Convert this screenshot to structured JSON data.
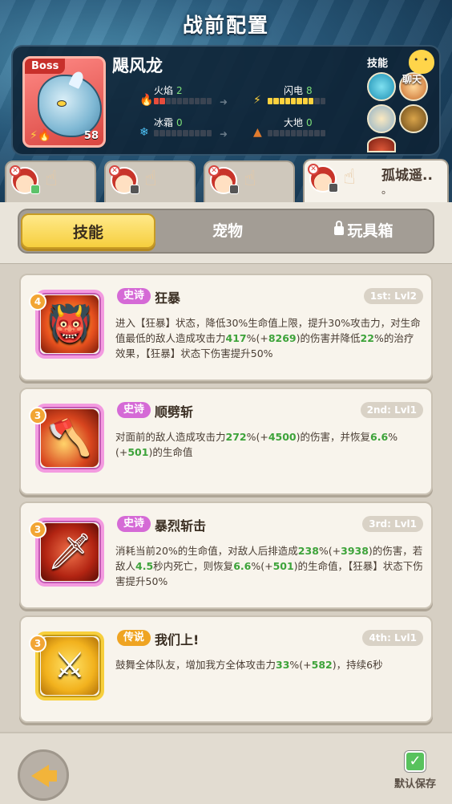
{
  "header": {
    "title": "战前配置"
  },
  "boss": {
    "tag": "Boss",
    "name": "飓风龙",
    "level": "58",
    "stats": [
      {
        "label": "火焰",
        "value": "2",
        "icon": "flame-icon",
        "filled": 2,
        "color": "#e74c3c"
      },
      {
        "label": "闪电",
        "value": "8",
        "icon": "lightning-icon",
        "filled": 8,
        "color": "#ffd23e"
      },
      {
        "label": "冰霜",
        "value": "0",
        "icon": "snowflake-icon",
        "filled": 0,
        "color": "#4fc3f7"
      },
      {
        "label": "大地",
        "value": "0",
        "icon": "mountain-icon",
        "filled": 0,
        "color": "#e07b2e"
      }
    ],
    "skills_label": "技能",
    "chat_label": "聊天"
  },
  "heroes": [
    {
      "name": ""
    },
    {
      "name": ""
    },
    {
      "name": ""
    },
    {
      "name": "孤城遥.."
    }
  ],
  "hero_name_tail": "。",
  "tabs": [
    {
      "label": "技能",
      "active": true
    },
    {
      "label": "宠物",
      "active": false
    },
    {
      "label": "玩具箱",
      "active": false,
      "locked": true
    }
  ],
  "skills": [
    {
      "rank": "4",
      "rarity": "史诗",
      "name": "狂暴",
      "slot": "1st: Lvl2",
      "desc": [
        "进入【狂暴】状态，降低30%生命值上限，提升30%攻击力，对生命值最低的敌人造成攻击力",
        "417",
        "%(+",
        "8269",
        ")的伤害并降低",
        "22",
        "%的治疗效果，【狂暴】状态下伤害提升50%"
      ]
    },
    {
      "rank": "3",
      "rarity": "史诗",
      "name": "顺劈斩",
      "slot": "2nd: Lvl1",
      "desc": [
        "对面前的敌人造成攻击力",
        "272",
        "%(+",
        "4500",
        ")的伤害，并恢复",
        "6.6",
        "%(+",
        "501",
        ")的生命值"
      ]
    },
    {
      "rank": "3",
      "rarity": "史诗",
      "name": "暴烈斩击",
      "slot": "3rd: Lvl1",
      "desc": [
        "消耗当前20%的生命值，对敌人后排造成",
        "238",
        "%(+",
        "3938",
        ")的伤害，若敌人",
        "4.5",
        "秒内死亡，则恢复",
        "6.6",
        "%(+",
        "501",
        ")的生命值，【狂暴】状态下伤害提升50%"
      ]
    },
    {
      "rank": "3",
      "rarity": "传说",
      "name": "我们上!",
      "slot": "4th: Lvl1",
      "desc": [
        "鼓舞全体队友，增加我方全体攻击力",
        "33",
        "%(+",
        "582",
        ")，持续6秒"
      ]
    }
  ],
  "footer": {
    "save_label": "默认保存"
  }
}
